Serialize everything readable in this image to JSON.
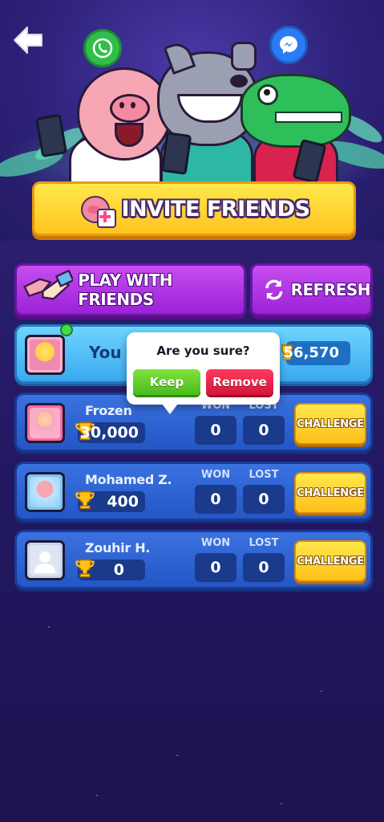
{
  "header": {
    "back_icon": "back-arrow-icon",
    "whatsapp_icon": "whatsapp-icon",
    "messenger_icon": "messenger-icon"
  },
  "invite": {
    "label": "INVITE FRIENDS",
    "icon": "pig-add-friend-icon"
  },
  "actions": {
    "play_with_friends": "PLAY WITH FRIENDS",
    "refresh": "REFRESH"
  },
  "me": {
    "name": "You",
    "score": "56,570"
  },
  "friends": [
    {
      "name": "Frozen",
      "score": "30,000",
      "won_label": "WON",
      "lost_label": "LOST",
      "won": "0",
      "lost": "0",
      "challenge": "CHALLENGE"
    },
    {
      "name": "Mohamed Z.",
      "score": "400",
      "won_label": "WON",
      "lost_label": "LOST",
      "won": "0",
      "lost": "0",
      "challenge": "CHALLENGE"
    },
    {
      "name": "Zouhir H.",
      "score": "0",
      "won_label": "WON",
      "lost_label": "LOST",
      "won": "0",
      "lost": "0",
      "challenge": "CHALLENGE"
    }
  ],
  "popup": {
    "title": "Are you sure?",
    "keep": "Keep",
    "remove": "Remove"
  },
  "colors": {
    "background": "#221862",
    "invite_yellow": "#ffd830",
    "purple": "#b63ae6",
    "row_blue": "#2f64d6",
    "me_row": "#52bff6",
    "keep_green": "#5cc82a",
    "remove_red": "#e8234a"
  }
}
